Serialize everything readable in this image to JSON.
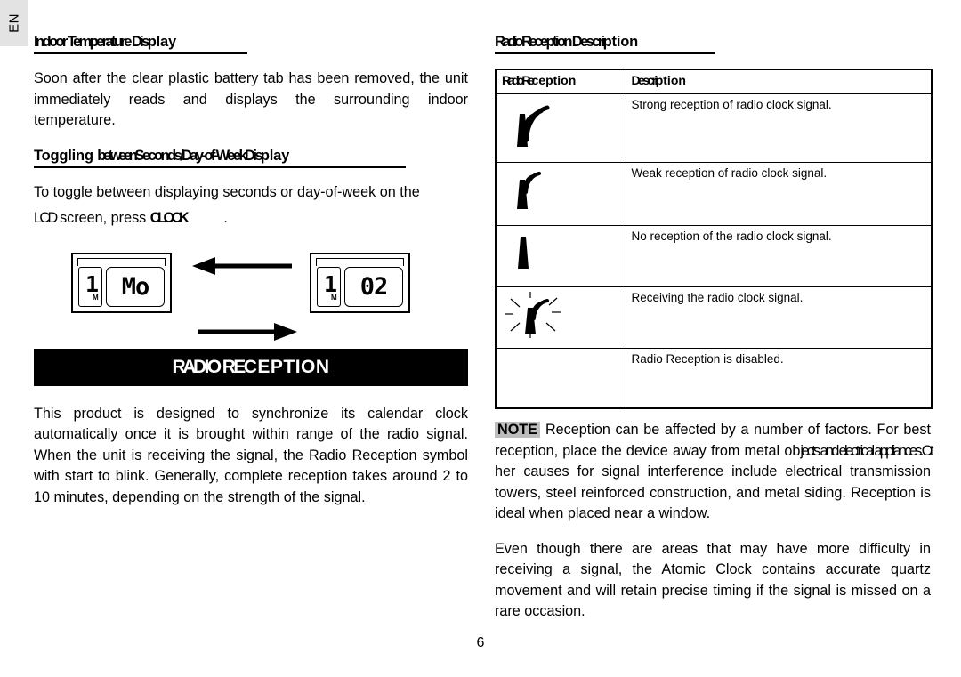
{
  "language_tab": {
    "label": "EN"
  },
  "page": {
    "number": "6"
  },
  "left_column": {
    "heading_indoor": {
      "part1": "Indoor Tem",
      "part2": "perature Dis",
      "part3": "play"
    },
    "paragraph_indoor": "Soon after the clear plastic battery tab has been removed, the unit immediately reads and displays the surrounding indoor temperature.",
    "heading_toggling": {
      "part1": "Toggling ",
      "part2": "between ",
      "part3": "Seconds",
      "part4": "/Day",
      "part5": "-of-",
      "part6": "Week",
      "part7": " Dis",
      "part8": "play"
    },
    "paragraph_toggle_1": "To toggle between displaying seconds or day-of-week on the",
    "paragraph_toggle_2a": "LCD",
    "paragraph_toggle_2b": " screen, press ",
    "paragraph_toggle_2c": "CLOCK",
    "paragraph_toggle_2d": ".",
    "lcd_left": {
      "digit": "1",
      "subscript": "M",
      "display": "Mo"
    },
    "lcd_right": {
      "digit": "1",
      "subscript": "M",
      "display": "02"
    },
    "arrows": {
      "top": "arrow-left",
      "bottom": "arrow-right"
    },
    "banner": {
      "part1": "RA",
      "part2": "DIO RE",
      "part3": "CEPTION"
    },
    "paragraph_radio": "This product is designed to synchronize its calendar clock automatically once it is brought within range of the radio signal. When the unit is receiving the signal, the Radio Reception symbol with start to blink. Generally, complete reception takes around 2 to 10 minutes, depending on the strength of the signal."
  },
  "right_column": {
    "heading_description": {
      "part1": "Ra",
      "part2": "dio Re",
      "part3": "ception Descri",
      "part4": "ption"
    },
    "table": {
      "headers": {
        "col1_part1": "Ra",
        "col1_part2": "dio Re",
        "col1_part3": "ception",
        "col2_part1": "Descri",
        "col2_part2": "ption"
      },
      "rows": [
        {
          "icon": "antenna-strong-icon",
          "description": "Strong reception of radio clock signal."
        },
        {
          "icon": "antenna-weak-icon",
          "description": "Weak reception of radio clock signal."
        },
        {
          "icon": "antenna-none-icon",
          "description": "No reception of the radio clock signal."
        },
        {
          "icon": "antenna-blinking-icon",
          "description": "Receiving the radio clock signal."
        },
        {
          "icon": "no-icon",
          "description": "Radio Reception is disabled."
        }
      ]
    },
    "note": {
      "badge": "NOTE",
      "text_a": "Reception can be affected by a number of factors. For best reception, place the device away from metal ob",
      "text_b": "jects and electrical appliances. ",
      "text_c": "Ot",
      "text_d": "her causes for signal interference include electrical transmission towers, steel reinforced construction, and metal siding. Reception is ideal when placed near a window."
    },
    "paragraph_quartz": "Even though there are areas that may have more difficulty in receiving a signal, the Atomic Clock contains accurate quartz movement and will retain precise timing if the signal is missed on a rare occasion."
  }
}
